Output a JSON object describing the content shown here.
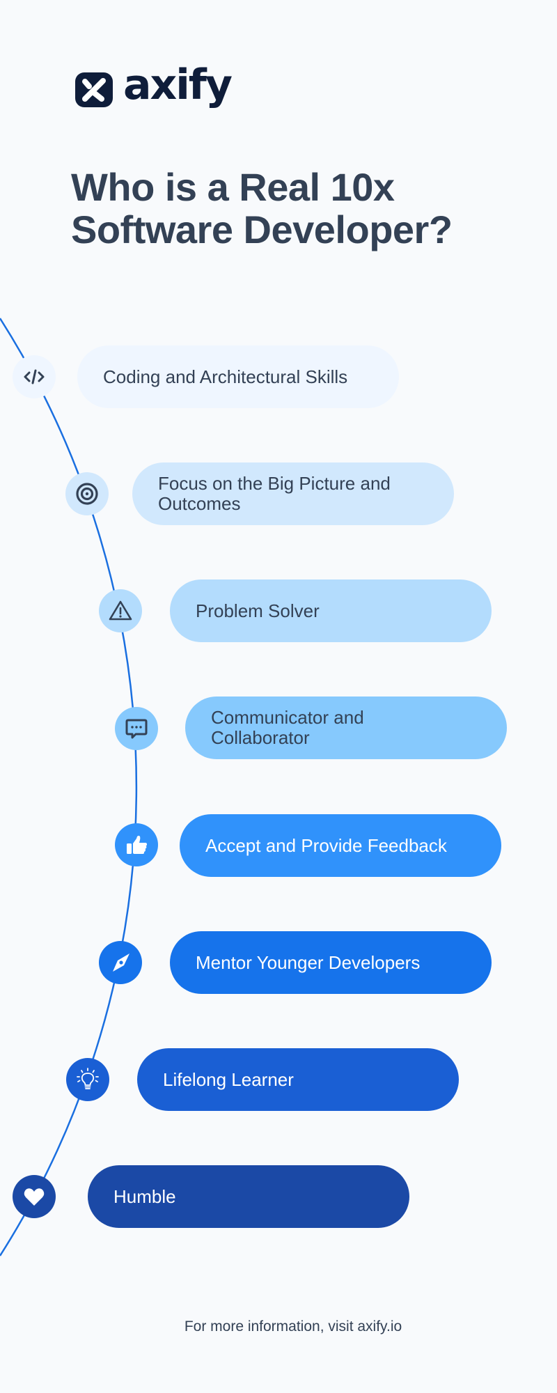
{
  "brand": {
    "name": "axify",
    "logo_icon": "axify-x-logo-icon",
    "color": "#0f1d3a"
  },
  "title": {
    "line1": "Who is a Real 10x",
    "line2": "Software Developer?"
  },
  "timeline": {
    "line_color": "#1a6fe0",
    "items": [
      {
        "label": "Coding and Architectural Skills",
        "icon": "code-icon",
        "bg": "#eff6ff",
        "text_color": "#334155",
        "icon_color": "#334155"
      },
      {
        "label": "Focus on the Big Picture and Outcomes",
        "icon": "target-icon",
        "bg": "#d1e8fd",
        "text_color": "#334155",
        "icon_color": "#334155"
      },
      {
        "label": "Problem Solver",
        "icon": "warning-triangle-icon",
        "bg": "#b3dcfd",
        "text_color": "#334155",
        "icon_color": "#334155"
      },
      {
        "label": "Communicator and Collaborator",
        "icon": "chat-bubble-icon",
        "bg": "#86c9fd",
        "text_color": "#334155",
        "icon_color": "#334155"
      },
      {
        "label": "Accept and Provide Feedback",
        "icon": "thumbs-up-icon",
        "bg": "#3092fb",
        "text_color": "#ffffff",
        "icon_color": "#ffffff"
      },
      {
        "label": "Mentor Younger Developers",
        "icon": "compass-icon",
        "bg": "#1673eb",
        "text_color": "#ffffff",
        "icon_color": "#ffffff"
      },
      {
        "label": "Lifelong Learner",
        "icon": "lightbulb-icon",
        "bg": "#1a5fd4",
        "text_color": "#ffffff",
        "icon_color": "#ffffff"
      },
      {
        "label": "Humble",
        "icon": "heart-icon",
        "bg": "#1b49a6",
        "text_color": "#ffffff",
        "icon_color": "#ffffff"
      }
    ]
  },
  "footer": {
    "text": "For more information, visit axify.io"
  }
}
